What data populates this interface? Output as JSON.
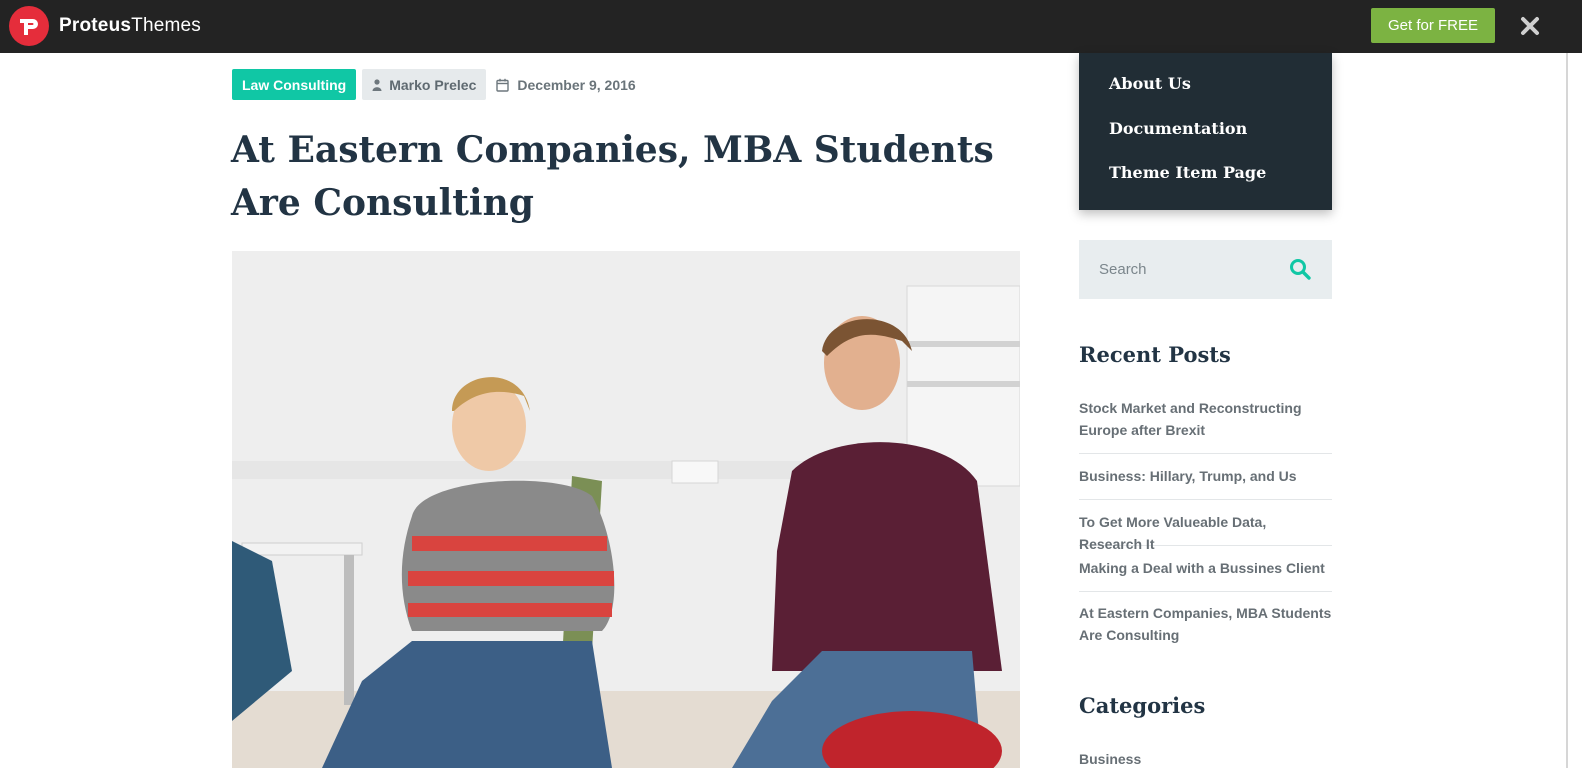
{
  "topbar": {
    "brand_bold": "Proteus",
    "brand_light": "Themes",
    "cta_label": "Get for FREE",
    "colors": {
      "bar": "#232323",
      "logo": "#e52d3b",
      "cta": "#7cb342"
    }
  },
  "post": {
    "category": "Law Consulting",
    "author": "Marko Prelec",
    "date": "December 9, 2016",
    "title": "At Eastern Companies, MBA Students Are Consulting"
  },
  "menu": {
    "items": [
      {
        "label": "About Us"
      },
      {
        "label": "Documentation"
      },
      {
        "label": "Theme Item Page"
      }
    ]
  },
  "sidebar": {
    "search_placeholder": "Search",
    "recent_title": "Recent Posts",
    "recent_posts": [
      {
        "label": "Stock Market and Reconstructing Europe after Brexit"
      },
      {
        "label": "Business: Hillary, Trump, and Us"
      },
      {
        "label": "To Get More Valueable Data, Research It"
      },
      {
        "label": "Making a Deal with a Bussines Client"
      },
      {
        "label": "At Eastern Companies, MBA Students Are Consulting"
      }
    ],
    "categories_title": "Categories",
    "categories": [
      {
        "label": "Business"
      }
    ]
  },
  "colors": {
    "accent": "#10c7a5",
    "heading": "#223444",
    "dropdown_bg": "#212d35"
  },
  "icons": [
    "proteus-logo-icon",
    "close-icon",
    "user-icon",
    "calendar-icon",
    "search-icon"
  ]
}
